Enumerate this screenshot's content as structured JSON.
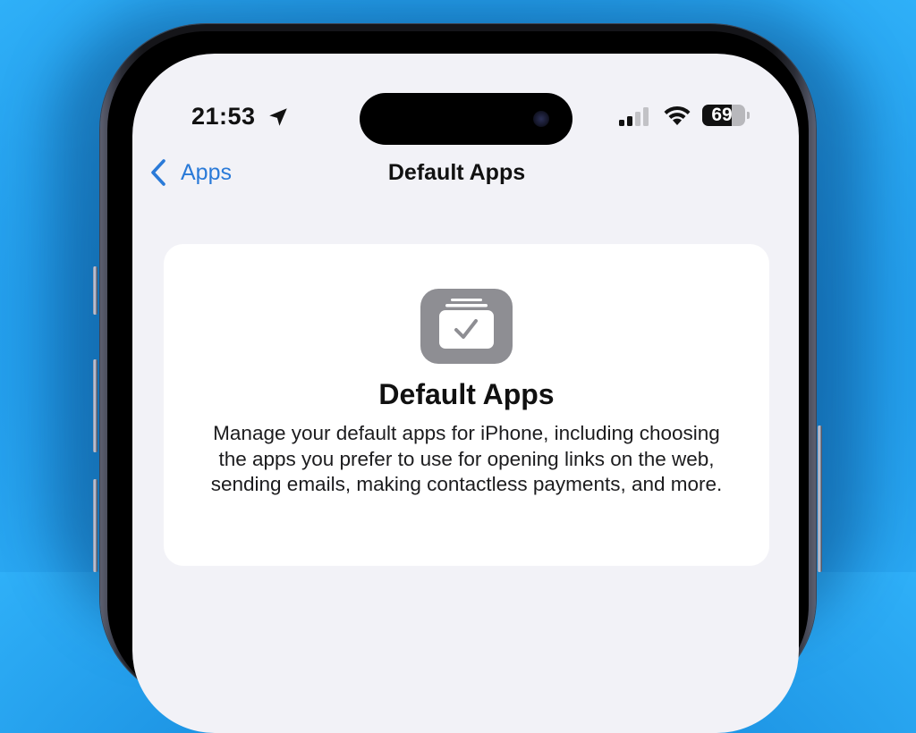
{
  "status_bar": {
    "time": "21:53",
    "location_icon": "location-arrow-icon",
    "signal_icon": "cellular-signal-icon",
    "wifi_icon": "wifi-icon",
    "battery_level": "69",
    "battery_percent": 69
  },
  "nav_bar": {
    "back_label": "Apps",
    "back_icon": "chevron-left-icon",
    "title": "Default Apps"
  },
  "card": {
    "icon": "default-apps-checkmark-icon",
    "title": "Default Apps",
    "description": "Manage your default apps for iPhone, including choosing the apps you prefer to use for opening links on the web, sending emails, making contactless payments, and more."
  },
  "colors": {
    "accent": "#2a7ad8",
    "background": "#f2f2f7",
    "card": "#ffffff",
    "icon_gray": "#8e8e93",
    "backdrop_blue": "#1a8fe0"
  }
}
